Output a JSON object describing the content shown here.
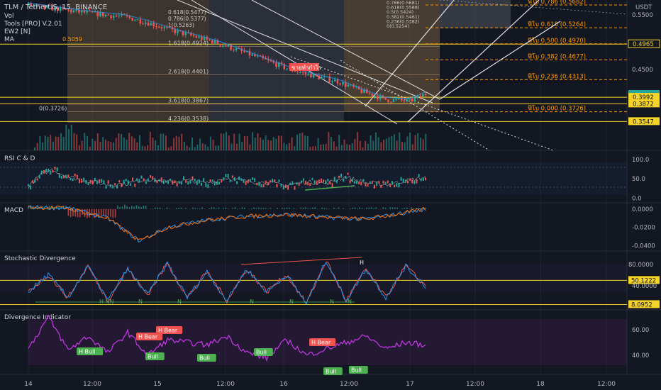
{
  "header": {
    "symbol": "TLM / TetherUS, 15, BINANCE",
    "lines": [
      "Vol",
      "Tools [PRO] V.2.01",
      "EW2 [N]",
      "MA"
    ],
    "ma_value": "0.5059"
  },
  "currency": "USDT",
  "price_axis": {
    "ticks": [
      {
        "value": 0.55,
        "label": "0.5500"
      },
      {
        "value": 0.45,
        "label": "0.4500"
      }
    ],
    "tags": [
      {
        "value": 0.4965,
        "label": "0.4965",
        "style": "outline"
      },
      {
        "value": 0.4046,
        "label": "0.4046",
        "style": "last"
      },
      {
        "value": 0.4022,
        "label": "09:05",
        "style": "timer"
      },
      {
        "value": 0.3992,
        "label": "0.3992",
        "style": "yellow"
      },
      {
        "value": 0.3872,
        "label": "0.3872",
        "style": "yellow"
      },
      {
        "value": 0.3547,
        "label": "0.3547",
        "style": "yellow"
      }
    ]
  },
  "fib_right": [
    {
      "label": "ฟีโบ 0.786 (0.5682)",
      "value": 0.5682
    },
    {
      "label": "ฟีโบ 0.618 (0.5264)",
      "value": 0.5264
    },
    {
      "label": "ฟีโบ 0.500 (0.4970)",
      "value": 0.497
    },
    {
      "label": "ฟีโบ 0.382 (0.4677)",
      "value": 0.4677
    },
    {
      "label": "ฟีโบ 0.236 (0.4313)",
      "value": 0.4313
    },
    {
      "label": "ฟีโบ 0.000 (0.3726)",
      "value": 0.3726
    }
  ],
  "fib_ext": [
    {
      "label": "1.618(0.4924)",
      "value": 0.4924
    },
    {
      "label": "2.618(0.4401)",
      "value": 0.4401
    },
    {
      "label": "3.618(0.3867)",
      "value": 0.3867
    },
    {
      "label": "4.236(0.3538)",
      "value": 0.3538
    },
    {
      "label": "0(0.3726)",
      "value": 0.3726
    }
  ],
  "fib_mini_left": [
    "0.618(0.5477)",
    "0.786(0.5377)",
    "1(0.5263)"
  ],
  "fib_mini_right": [
    "0.786(0.5681)",
    "0.618(0.5588)",
    "0.5(0.5424)",
    "0.382(0.5461)",
    "0.236(0.5382)",
    "0(0.5254)"
  ],
  "signal_label": "ขายทำกำไร",
  "chart_data": [
    {
      "type": "line",
      "title": "TLM / TetherUS, 15, BINANCE",
      "x_ticks": [
        "14",
        "12:00",
        "15",
        "12:00",
        "16",
        "12:00",
        "17",
        "12:00",
        "18",
        "12:00"
      ],
      "ylim": [
        0.345,
        0.58
      ],
      "grid": true,
      "series": [
        {
          "x": [
            0,
            6,
            12,
            18,
            24,
            30,
            36,
            42,
            48,
            54,
            60,
            66,
            72,
            78,
            84,
            90,
            96,
            100
          ],
          "values": [
            0.568,
            0.562,
            0.556,
            0.551,
            0.547,
            0.536,
            0.522,
            0.51,
            0.498,
            0.482,
            0.466,
            0.45,
            0.438,
            0.428,
            0.41,
            0.395,
            0.392,
            0.405
          ]
        }
      ]
    },
    {
      "type": "line",
      "title": "RSI C & D",
      "yticks": [
        "100.0",
        "50.0",
        "0.0"
      ],
      "ylim": [
        -10,
        120
      ],
      "series": [
        {
          "x": [
            0,
            3,
            6,
            10,
            15,
            20,
            25,
            30,
            35,
            40,
            45,
            50,
            55,
            60,
            65,
            70,
            75,
            80,
            85,
            90,
            95,
            100
          ],
          "values": [
            30,
            60,
            75,
            55,
            45,
            35,
            38,
            50,
            42,
            46,
            40,
            52,
            44,
            40,
            33,
            42,
            38,
            55,
            40,
            35,
            45,
            55
          ]
        }
      ]
    },
    {
      "type": "line",
      "title": "MACD",
      "yticks": [
        "0.0000",
        "-0.0200",
        "-0.0400"
      ],
      "ylim": [
        -0.045,
        0.006
      ],
      "series": [
        {
          "x": [
            0,
            10,
            20,
            28,
            35,
            45,
            55,
            65,
            75,
            85,
            95,
            100
          ],
          "values": [
            0.002,
            0.001,
            -0.01,
            -0.035,
            -0.02,
            -0.012,
            -0.008,
            -0.006,
            -0.009,
            -0.011,
            -0.004,
            0.0
          ]
        }
      ]
    },
    {
      "type": "line",
      "title": "Stochastic Divergence",
      "yticks": [
        "80.0000",
        "40.0000"
      ],
      "ylim": [
        0,
        100
      ],
      "series": [
        {
          "x": [
            0,
            5,
            10,
            15,
            20,
            25,
            30,
            35,
            40,
            45,
            50,
            55,
            60,
            65,
            70,
            75,
            80,
            85,
            90,
            95,
            100
          ],
          "values": [
            30,
            60,
            20,
            75,
            15,
            70,
            25,
            80,
            20,
            65,
            15,
            70,
            30,
            60,
            10,
            85,
            15,
            70,
            20,
            75,
            40
          ]
        }
      ]
    },
    {
      "type": "line",
      "title": "Divergence Indicator",
      "yticks": [
        "60.00",
        "40.00"
      ],
      "ylim": [
        25,
        75
      ],
      "series": [
        {
          "x": [
            0,
            5,
            10,
            15,
            20,
            25,
            30,
            35,
            40,
            45,
            50,
            55,
            60,
            65,
            70,
            75,
            80,
            85,
            90,
            95,
            100
          ],
          "values": [
            45,
            70,
            44,
            55,
            42,
            58,
            40,
            52,
            50,
            48,
            55,
            42,
            38,
            52,
            40,
            45,
            50,
            55,
            45,
            50,
            48
          ]
        }
      ]
    }
  ],
  "stoch_levels": [
    {
      "value": 50.1222,
      "label": "50.1222"
    },
    {
      "value": 8.0952,
      "label": "8.0952"
    }
  ],
  "stoch_markers": {
    "h": "H",
    "hnn": "H NN",
    "n": "N"
  },
  "div_labels": {
    "h_bear": "H Bear",
    "h_bull": "H Bull",
    "bull": "Bull"
  },
  "colors": {
    "up": "#26a69a",
    "down": "#ef5350",
    "yellow": "#f5d327",
    "fib": "#ff9800",
    "purple": "#c036e0",
    "rsi_fill": "#1e88e5"
  }
}
